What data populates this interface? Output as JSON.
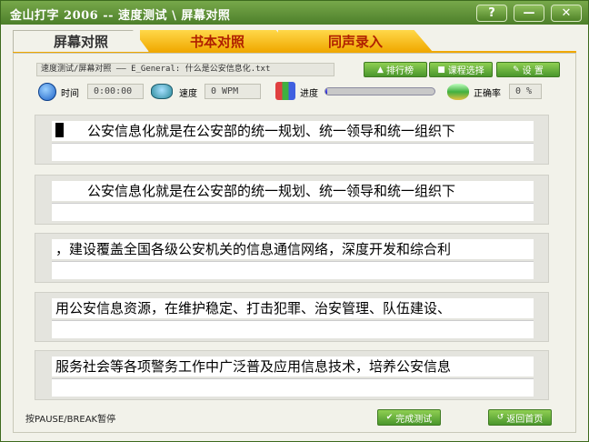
{
  "window": {
    "title": "金山打字 2006 -- 速度测试 \\ 屏幕对照",
    "help_label": "?",
    "minimize_label": "—",
    "close_label": "✕"
  },
  "tabs": [
    {
      "label": "屏幕对照",
      "active": true
    },
    {
      "label": "书本对照",
      "active": false
    },
    {
      "label": "同声录入",
      "active": false
    }
  ],
  "toolbar": {
    "path": "速度测试/屏幕对照 —— E_General: 什么是公安信息化.txt",
    "ranking_label": "排行榜",
    "course_label": "课程选择",
    "settings_label": "设 置"
  },
  "stats": {
    "time_label": "时间",
    "time_value": "0:00:00",
    "speed_label": "速度",
    "speed_value": "0 WPM",
    "progress_label": "进度",
    "progress_fraction": 0.02,
    "accuracy_label": "正确率",
    "accuracy_value": "0 %"
  },
  "lines": [
    {
      "text": "公安信息化就是在公安部的统一规划、统一领导和统一组织下",
      "has_cursor": true
    },
    {
      "text": "公安信息化就是在公安部的统一规划、统一领导和统一组织下",
      "has_cursor": false,
      "indent": true
    },
    {
      "text": "，建设覆盖全国各级公安机关的信息通信网络，深度开发和综合利",
      "has_cursor": false
    },
    {
      "text": "用公安信息资源，在维护稳定、打击犯罪、治安管理、队伍建设、",
      "has_cursor": false
    },
    {
      "text": "服务社会等各项警务工作中广泛普及应用信息技术，培养公安信息",
      "has_cursor": false
    }
  ],
  "footer": {
    "hint": "按PAUSE/BREAK暂停",
    "finish_label": "完成测试",
    "home_label": "返回首页"
  },
  "colors": {
    "title_green": "#4d7f2a",
    "tab_yellow": "#f0a800",
    "tab_text_red": "#b02000",
    "button_green": "#4a962c",
    "progress_blue": "#1010c0"
  }
}
